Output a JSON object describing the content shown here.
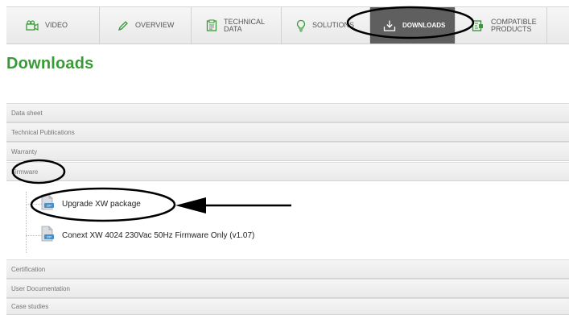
{
  "tabs": [
    {
      "label": "VIDEO",
      "icon": "video-camera-icon"
    },
    {
      "label": "OVERVIEW",
      "icon": "pencil-icon"
    },
    {
      "label": "TECHNICAL\nDATA",
      "icon": "document-spec-icon"
    },
    {
      "label": "SOLUTIONS",
      "icon": "lightbulb-icon"
    },
    {
      "label": "DOWNLOADS",
      "icon": "download-tray-icon",
      "active": true
    },
    {
      "label": "COMPATIBLE\nPRODUCTS",
      "icon": "puzzle-icon"
    }
  ],
  "page_title": "Downloads",
  "sections": {
    "data_sheet": "Data sheet",
    "technical_publications": "Technical Publications",
    "warranty": "Warranty",
    "firmware": "Firmware",
    "certification": "Certification",
    "user_documentation": "User Documentation",
    "case_studies": "Case studies"
  },
  "firmware_files": [
    {
      "label": "Upgrade XW package",
      "icon": "zip-file-icon"
    },
    {
      "label": "Conext XW 4024 230Vac 50Hz Firmware Only (v1.07)",
      "icon": "zip-file-icon"
    }
  ],
  "colors": {
    "accent_green": "#3a9a37",
    "active_tab": "#5f5f5f",
    "annotation": "#000000"
  }
}
